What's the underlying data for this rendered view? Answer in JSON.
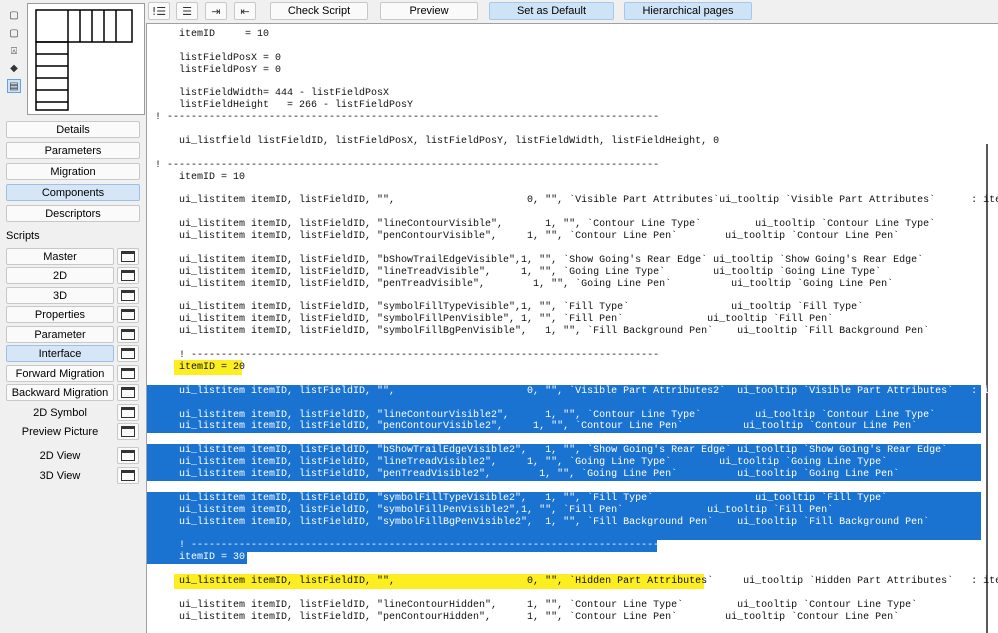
{
  "toolbar": {
    "check_script": "Check Script",
    "preview": "Preview",
    "set_as_default": "Set as Default",
    "hierarchical_pages": "Hierarchical pages"
  },
  "nav": {
    "details": "Details",
    "parameters": "Parameters",
    "migration": "Migration",
    "components": "Components",
    "descriptors": "Descriptors"
  },
  "scripts": {
    "label": "Scripts",
    "items": [
      {
        "label": "Master"
      },
      {
        "label": "2D"
      },
      {
        "label": "3D"
      },
      {
        "label": "Properties"
      },
      {
        "label": "Parameter"
      },
      {
        "label": "Interface"
      },
      {
        "label": "Forward Migration"
      },
      {
        "label": "Backward Migration"
      },
      {
        "label": "2D Symbol"
      },
      {
        "label": "Preview Picture"
      },
      {
        "label": "2D View"
      },
      {
        "label": "3D View"
      }
    ]
  },
  "code_lines": [
    {
      "text": "    itemID     = 10",
      "hl": ""
    },
    {
      "text": "",
      "hl": ""
    },
    {
      "text": "    listFieldPosX = 0",
      "hl": ""
    },
    {
      "text": "    listFieldPosY = 0",
      "hl": ""
    },
    {
      "text": "",
      "hl": ""
    },
    {
      "text": "    listFieldWidth= 444 - listFieldPosX",
      "hl": ""
    },
    {
      "text": "    listFieldHeight   = 266 - listFieldPosY",
      "hl": ""
    },
    {
      "text": "! ----------------------------------------------------------------------------------",
      "hl": ""
    },
    {
      "text": "",
      "hl": ""
    },
    {
      "text": "    ui_listfield listFieldID, listFieldPosX, listFieldPosY, listFieldWidth, listFieldHeight, 0",
      "hl": ""
    },
    {
      "text": "",
      "hl": ""
    },
    {
      "text": "! ----------------------------------------------------------------------------------",
      "hl": ""
    },
    {
      "text": "    itemID = 10",
      "hl": ""
    },
    {
      "text": "",
      "hl": ""
    },
    {
      "text": "    ui_listitem itemID, listFieldID, \"\",                      0, \"\", `Visible Part Attributes`ui_tooltip `Visible Part Attributes`      : ite",
      "hl": ""
    },
    {
      "text": "",
      "hl": ""
    },
    {
      "text": "    ui_listitem itemID, listFieldID, \"lineContourVisible\",       1, \"\", `Contour Line Type`         ui_tooltip `Contour Line Type`",
      "hl": ""
    },
    {
      "text": "    ui_listitem itemID, listFieldID, \"penContourVisible\",     1, \"\", `Contour Line Pen`        ui_tooltip `Contour Line Pen`",
      "hl": ""
    },
    {
      "text": "",
      "hl": ""
    },
    {
      "text": "    ui_listitem itemID, listFieldID, \"bShowTrailEdgeVisible\",1, \"\", `Show Going's Rear Edge` ui_tooltip `Show Going's Rear Edge`",
      "hl": ""
    },
    {
      "text": "    ui_listitem itemID, listFieldID, \"lineTreadVisible\",     1, \"\", `Going Line Type`        ui_tooltip `Going Line Type`",
      "hl": ""
    },
    {
      "text": "    ui_listitem itemID, listFieldID, \"penTreadVisible\",        1, \"\", `Going Line Pen`          ui_tooltip `Going Line Pen`",
      "hl": ""
    },
    {
      "text": "",
      "hl": ""
    },
    {
      "text": "    ui_listitem itemID, listFieldID, \"symbolFillTypeVisible\",1, \"\", `Fill Type`                 ui_tooltip `Fill Type`",
      "hl": ""
    },
    {
      "text": "    ui_listitem itemID, listFieldID, \"symbolFillPenVisible\", 1, \"\", `Fill Pen`              ui_tooltip `Fill Pen`",
      "hl": ""
    },
    {
      "text": "    ui_listitem itemID, listFieldID, \"symbolFillBgPenVisible\",   1, \"\", `Fill Background Pen`    ui_tooltip `Fill Background Pen`",
      "hl": ""
    },
    {
      "text": "",
      "hl": ""
    },
    {
      "text": "    ! ------------------------------------------------------------------------------",
      "hl": ""
    },
    {
      "text": "    itemID = 20",
      "hl": "yellow-short"
    },
    {
      "text": "",
      "hl": ""
    },
    {
      "text": "    ui_listitem itemID, listFieldID, \"\",                      0, \"\", `Visible Part Attributes2`  ui_tooltip `Visible Part Attributes`   : ite",
      "hl": "blue"
    },
    {
      "text": "",
      "hl": "blue-gap"
    },
    {
      "text": "    ui_listitem itemID, listFieldID, \"lineContourVisible2\",      1, \"\", `Contour Line Type`         ui_tooltip `Contour Line Type`",
      "hl": "blue"
    },
    {
      "text": "    ui_listitem itemID, listFieldID, \"penContourVisible2\",     1, \"\", `Contour Line Pen`          ui_tooltip `Contour Line Pen`",
      "hl": "blue"
    },
    {
      "text": "",
      "hl": ""
    },
    {
      "text": "    ui_listitem itemID, listFieldID, \"bShowTrailEdgeVisible2\",   1, \"\", `Show Going's Rear Edge` ui_tooltip `Show Going's Rear Edge`",
      "hl": "blue"
    },
    {
      "text": "    ui_listitem itemID, listFieldID, \"lineTreadVisible2\",     1, \"\", `Going Line Type`        ui_tooltip `Going Line Type`",
      "hl": "blue"
    },
    {
      "text": "    ui_listitem itemID, listFieldID, \"penTreadVisible2\",        1, \"\", `Going Line Pen`          ui_tooltip `Going Line Pen`",
      "hl": "blue"
    },
    {
      "text": "",
      "hl": ""
    },
    {
      "text": "    ui_listitem itemID, listFieldID, \"symbolFillTypeVisible2\",   1, \"\", `Fill Type`                 ui_tooltip `Fill Type`",
      "hl": "blue"
    },
    {
      "text": "    ui_listitem itemID, listFieldID, \"symbolFillPenVisible2\",1, \"\", `Fill Pen`              ui_tooltip `Fill Pen`",
      "hl": "blue"
    },
    {
      "text": "    ui_listitem itemID, listFieldID, \"symbolFillBgPenVisible2\",  1, \"\", `Fill Background Pen`    ui_tooltip `Fill Background Pen`",
      "hl": "blue"
    },
    {
      "text": "",
      "hl": "blue-gap"
    },
    {
      "text": "    ! ------------------------------------------------------------------------------",
      "hl": "blue-mid"
    },
    {
      "text": "    itemID = 30",
      "hl": "blue-short"
    },
    {
      "text": "",
      "hl": ""
    },
    {
      "text": "    ui_listitem itemID, listFieldID, \"\",                      0, \"\", `Hidden Part Attributes`     ui_tooltip `Hidden Part Attributes`   : ite",
      "hl": "yellow-long"
    },
    {
      "text": "",
      "hl": ""
    },
    {
      "text": "    ui_listitem itemID, listFieldID, \"lineContourHidden\",     1, \"\", `Contour Line Type`         ui_tooltip `Contour Line Type`",
      "hl": ""
    },
    {
      "text": "    ui_listitem itemID, listFieldID, \"penContourHidden\",      1, \"\", `Contour Line Pen`        ui_tooltip `Contour Line Pen`",
      "hl": ""
    }
  ]
}
